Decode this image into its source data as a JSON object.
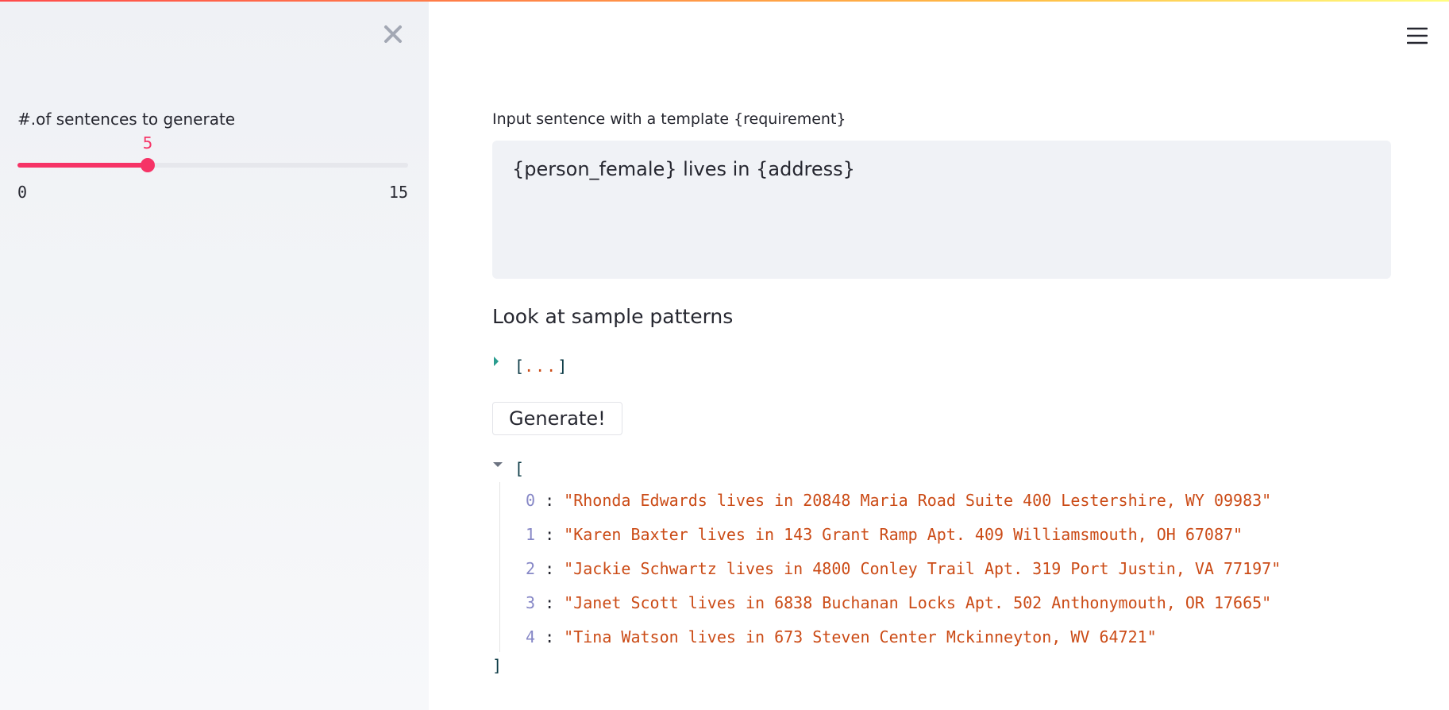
{
  "sidebar": {
    "slider": {
      "label": "#.of sentences to generate",
      "value": 5,
      "value_text": "5",
      "min": 0,
      "max": 15,
      "min_text": "0",
      "max_text": "15"
    }
  },
  "main": {
    "input_label": "Input sentence with a template {requirement}",
    "template_value": "{person_female} lives in {address}",
    "sample_heading": "Look at sample patterns",
    "sample_json": {
      "open": "[",
      "ellipsis": "...",
      "close": "]"
    },
    "generate_label": "Generate!",
    "results": {
      "open": "[",
      "close": "]",
      "items": [
        {
          "index": "0",
          "text": "\"Rhonda Edwards lives in 20848 Maria Road Suite 400 Lestershire, WY 09983\""
        },
        {
          "index": "1",
          "text": "\"Karen Baxter lives in 143 Grant Ramp Apt. 409 Williamsmouth, OH 67087\""
        },
        {
          "index": "2",
          "text": "\"Jackie Schwartz lives in 4800 Conley Trail Apt. 319 Port Justin, VA 77197\""
        },
        {
          "index": "3",
          "text": "\"Janet Scott lives in 6838 Buchanan Locks Apt. 502 Anthonymouth, OR 17665\""
        },
        {
          "index": "4",
          "text": "\"Tina Watson lives in 673 Steven Center Mckinneyton, WV 64721\""
        }
      ]
    }
  },
  "colors": {
    "accent": "#f63366",
    "string": "#cb4b16",
    "index": "#8687c6",
    "input_bg": "#f0f2f6",
    "sidebar_bg": "#f0f2f6"
  },
  "icons": {
    "close": "close-icon",
    "menu": "hamburger-menu-icon",
    "collapsed": "caret-right-icon",
    "expanded": "caret-down-icon"
  }
}
